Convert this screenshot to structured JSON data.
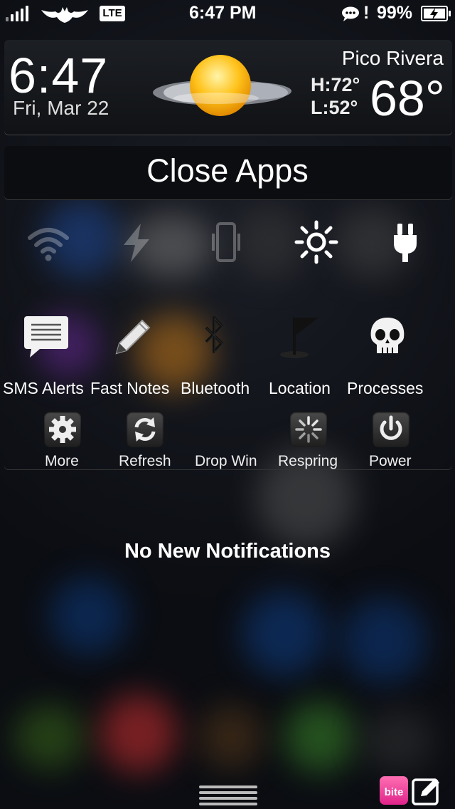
{
  "status_bar": {
    "carrier_icon": "batman-logo-icon",
    "network": "LTE",
    "time": "6:47 PM",
    "alert": "!",
    "battery_percent": "99%",
    "battery_level": 0.99
  },
  "weather": {
    "time": "6:47",
    "date": "Fri, Mar 22",
    "city": "Pico Rivera",
    "high": "H:72°",
    "low": "L:52°",
    "temperature": "68°",
    "condition_icon": "partly-cloudy-sun-icon"
  },
  "close_apps": {
    "label": "Close Apps"
  },
  "toggles": [
    {
      "icon": "wifi-icon",
      "state": "off"
    },
    {
      "icon": "flash-icon",
      "state": "off"
    },
    {
      "icon": "vibrate-icon",
      "state": "off"
    },
    {
      "icon": "brightness-icon",
      "state": "on"
    },
    {
      "icon": "power-plug-icon",
      "state": "on"
    }
  ],
  "apps": [
    {
      "label": "SMS Alerts",
      "icon": "message-icon"
    },
    {
      "label": "Fast Notes",
      "icon": "pencil-icon"
    },
    {
      "label": "Bluetooth",
      "icon": "bluetooth-icon"
    },
    {
      "label": "Location",
      "icon": "flag-icon"
    },
    {
      "label": "Processes",
      "icon": "skull-icon"
    }
  ],
  "actions": [
    {
      "label": "More",
      "icon": "gear-icon"
    },
    {
      "label": "Refresh",
      "icon": "refresh-icon"
    },
    {
      "label": "Drop Win",
      "icon": ""
    },
    {
      "label": "Respring",
      "icon": "spinner-icon"
    },
    {
      "label": "Power",
      "icon": "power-icon"
    }
  ],
  "notifications": {
    "empty_text": "No New Notifications"
  },
  "bottom": {
    "bite_label": "bite",
    "compose_icon": "compose-icon"
  },
  "colors": {
    "bite_pink": "#e0248a",
    "sun": "#ffc21a"
  }
}
